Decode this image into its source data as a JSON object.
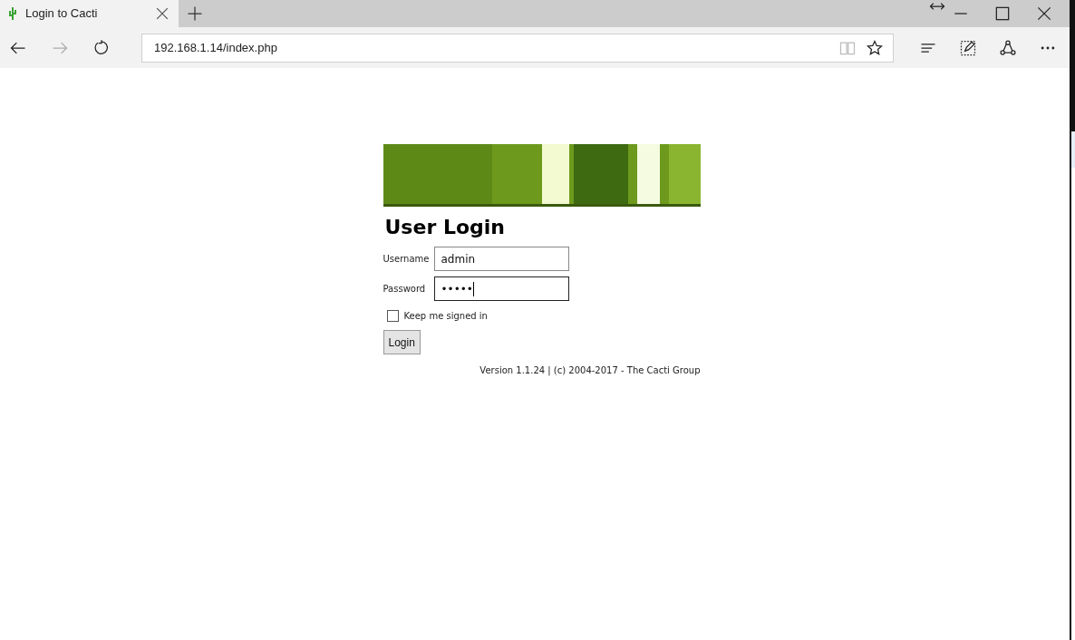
{
  "tab": {
    "title": "Login to Cacti",
    "selected": true
  },
  "address_bar": {
    "url": "192.168.1.14/index.php"
  },
  "login": {
    "title": "User Login",
    "fields": [
      {
        "label": "Username",
        "value": "admin",
        "focused": false
      },
      {
        "label": "Password",
        "value": "•••••",
        "focused": true
      }
    ],
    "remember": {
      "label": "Keep me signed in",
      "checked": false
    },
    "button": "Login",
    "footer": "Version 1.1.24 | (c) 2004-2017 - The Cacti Group"
  }
}
